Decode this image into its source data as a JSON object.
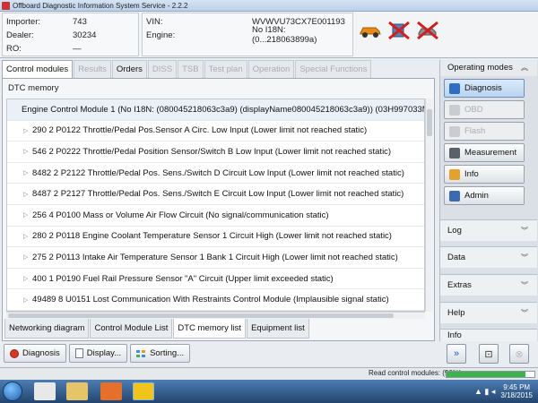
{
  "window": {
    "title": "Offboard Diagnostic Information System Service - 2.2.2"
  },
  "header": {
    "importer_label": "Importer:",
    "importer_value": "743",
    "dealer_label": "Dealer:",
    "dealer_value": "30234",
    "ro_label": "RO:",
    "ro_value": "—",
    "vin_label": "VIN:",
    "vin_value": "WVWVU73CX7E001193",
    "engine_label": "Engine:",
    "engine_value": "No I18N: (0...218063899a)"
  },
  "tabs": [
    {
      "label": "Control modules",
      "state": "active"
    },
    {
      "label": "Results",
      "state": "disabled"
    },
    {
      "label": "Orders",
      "state": "enabled"
    },
    {
      "label": "DISS",
      "state": "disabled"
    },
    {
      "label": "TSB",
      "state": "disabled"
    },
    {
      "label": "Test plan",
      "state": "disabled"
    },
    {
      "label": "Operation",
      "state": "disabled"
    },
    {
      "label": "Special Functions",
      "state": "disabled"
    }
  ],
  "dtc_panel": {
    "title": "DTC memory",
    "header_row": "Engine Control Module 1 (No I18N: (080045218063c3a9) (displayName080045218063c3a9)) (03H997033M",
    "rows": [
      "290   2   P0122   Throttle/Pedal Pos.Sensor A Circ. Low Input   (Lower limit not reached   static)",
      "546   2   P0222   Throttle/Pedal Position Sensor/Switch B Low Input   (Lower limit not reached   static)",
      "8482   2   P2122   Throttle/Pedal Pos. Sens./Switch D Circuit Low Input   (Lower limit not reached   static)",
      "8487   2   P2127   Throttle/Pedal Pos. Sens./Switch E Circuit Low Input   (Lower limit not reached   static)",
      "256   4   P0100   Mass or Volume Air Flow Circuit   (No signal/communication   static)",
      "280   2   P0118   Engine Coolant Temperature Sensor 1 Circuit High   (Lower limit not reached   static)",
      "275   2   P0113   Intake Air Temperature Sensor 1 Bank 1 Circuit High   (Lower limit not reached   static)",
      "400   1   P0190   Fuel Rail Pressure Sensor \"A\" Circuit   (Upper limit exceeded   static)",
      "49489   8   U0151   Lost Communication With Restraints Control Module   (Implausible signal   static)"
    ]
  },
  "subtabs": [
    {
      "label": "Networking diagram",
      "active": false
    },
    {
      "label": "Control Module List",
      "active": false
    },
    {
      "label": "DTC memory list",
      "active": true
    },
    {
      "label": "Equipment list",
      "active": false
    }
  ],
  "bottom_buttons": {
    "diagnosis": "Diagnosis",
    "display": "Display...",
    "sorting": "Sorting..."
  },
  "operating_modes": {
    "title": "Operating modes",
    "buttons": [
      {
        "label": "Diagnosis",
        "state": "active",
        "icon": "diagnosis-icon",
        "color": "#2f6cc4"
      },
      {
        "label": "OBD",
        "state": "disabled",
        "icon": "obd-icon",
        "color": "#c9cdd2"
      },
      {
        "label": "Flash",
        "state": "disabled",
        "icon": "flash-icon",
        "color": "#c9cdd2"
      },
      {
        "label": "Measurement",
        "state": "enabled",
        "icon": "measurement-icon",
        "color": "#5b6168"
      },
      {
        "label": "Info",
        "state": "enabled",
        "icon": "info-icon",
        "color": "#e2a22b"
      },
      {
        "label": "Admin",
        "state": "enabled",
        "icon": "admin-icon",
        "color": "#3c69b0"
      }
    ]
  },
  "right_sections": [
    "Log",
    "Data",
    "Extras",
    "Help",
    "Info"
  ],
  "status": {
    "text": "Read control modules: (90%)",
    "progress": 0.9
  },
  "clock": {
    "time": "9:45 PM",
    "date": "3/18/2015"
  },
  "colors": {
    "accent": "#2f6cc4",
    "progress": "#3bb54a"
  }
}
